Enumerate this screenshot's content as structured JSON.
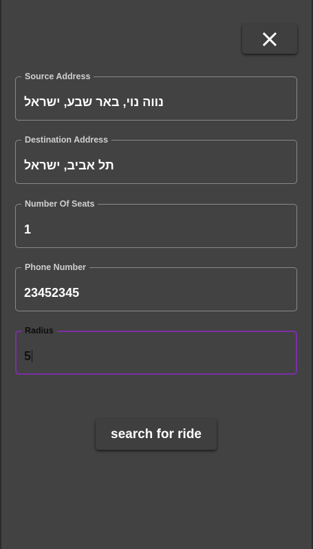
{
  "close_button": {
    "icon": "close-icon",
    "color": "#ffffff"
  },
  "form": {
    "source_address": {
      "label": "Source Address",
      "value": "נווה נוי, באר שבע, ישראל"
    },
    "destination_address": {
      "label": "Destination Address",
      "value": "תל אביב, ישראל"
    },
    "number_of_seats": {
      "label": "Number Of Seats",
      "value": "1"
    },
    "phone_number": {
      "label": "Phone Number",
      "value": "23452345"
    },
    "radius": {
      "label": "Radius",
      "value": "5",
      "focused": true
    }
  },
  "search_button": {
    "label": "search for ride"
  },
  "colors": {
    "background": "#424242",
    "focus_accent": "#7b2fa6",
    "field_border": "#8a8a8a",
    "text": "#ffffff"
  }
}
